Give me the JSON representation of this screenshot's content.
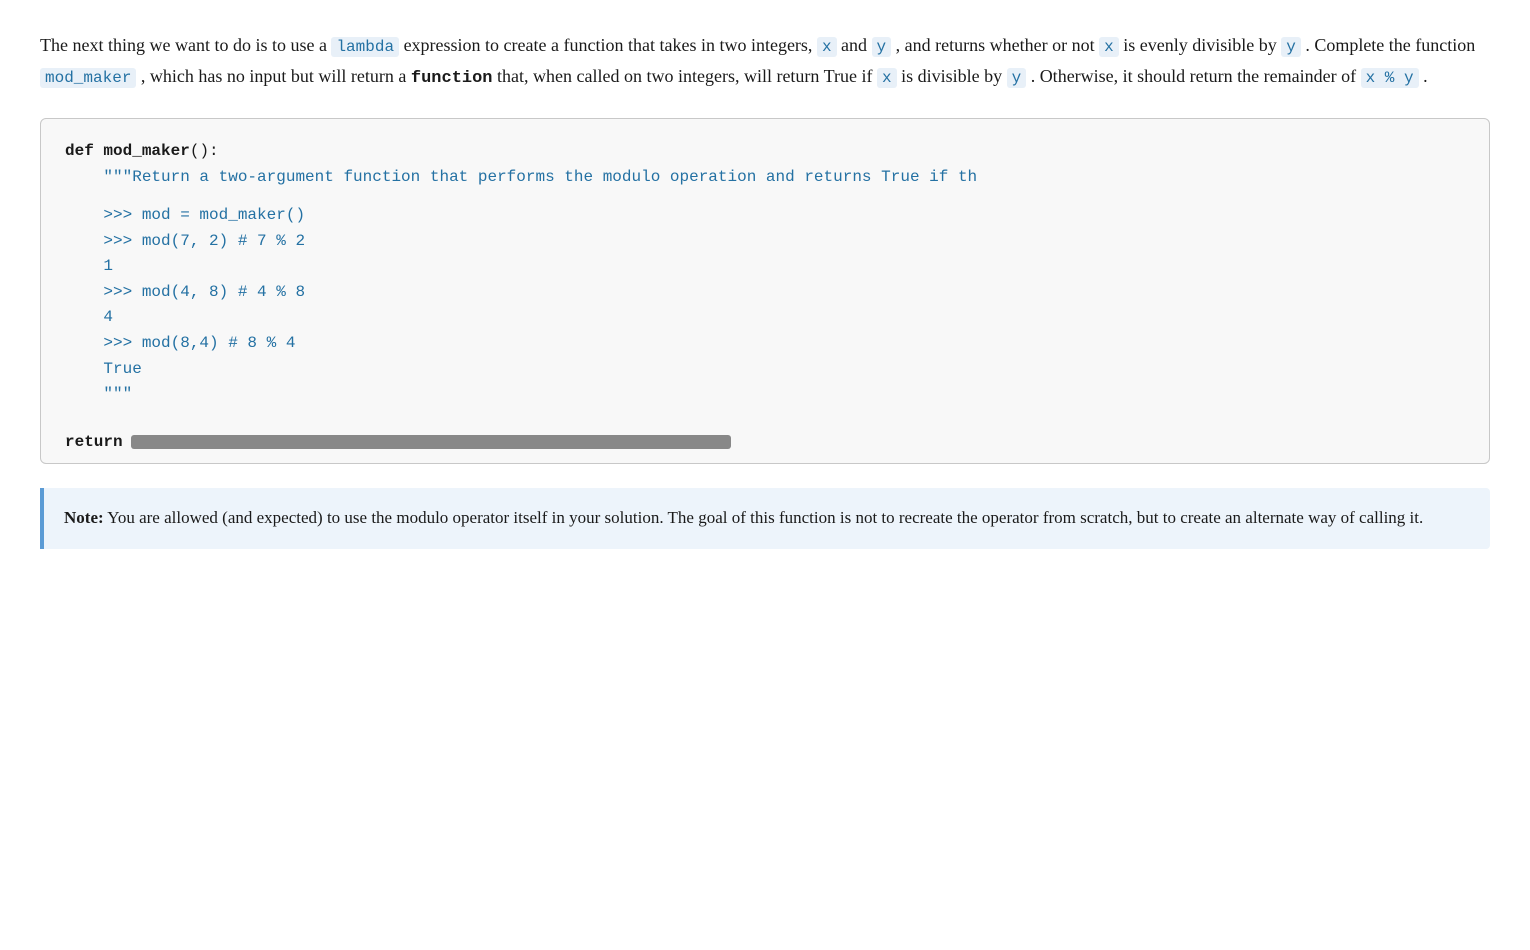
{
  "description": {
    "part1": "The next thing we want to do is to use a ",
    "lambda_code": "lambda",
    "part2": " expression to create a function that takes in two integers, ",
    "x_code1": "x",
    "part3": " and ",
    "y_code1": "y",
    "part4": " , and returns whether or not ",
    "x_code2": "x",
    "part5": " is evenly divisible by ",
    "y_code2": "y",
    "part6": " . Complete the function ",
    "mod_maker_code": "mod_maker",
    "part7": " , which has no input but will return a ",
    "function_bold": "function",
    "part8": " that, when called on two integers, will return True if ",
    "x_code3": "x",
    "part9": " is divisible by ",
    "y_code3": "y",
    "part10": " . Otherwise, it should return the remainder of ",
    "xy_code": "x % y",
    "part11": " ."
  },
  "code_block": {
    "def_line": "def mod_maker():",
    "docstring_line1": "    \"\"\"Return a two-argument function that performs the modulo operation and returns True if th",
    "empty1": "",
    "prompt1": "    >>> mod = mod_maker()",
    "prompt2": "    >>> mod(7, 2) # 7 % 2",
    "result1": "    1",
    "prompt3": "    >>> mod(4, 8) # 4 % 8",
    "result2": "    4",
    "prompt4": "    >>> mod(8,4) # 8 % 4",
    "result3": "    True",
    "docstring_close": "    \"\"\"",
    "empty2": "",
    "return_keyword": "    return"
  },
  "note": {
    "bold_label": "Note:",
    "text": " You are allowed (and expected) to use the modulo operator itself in your solution. The goal of this function is not to recreate the operator from scratch, but to create an alternate way of calling it."
  }
}
